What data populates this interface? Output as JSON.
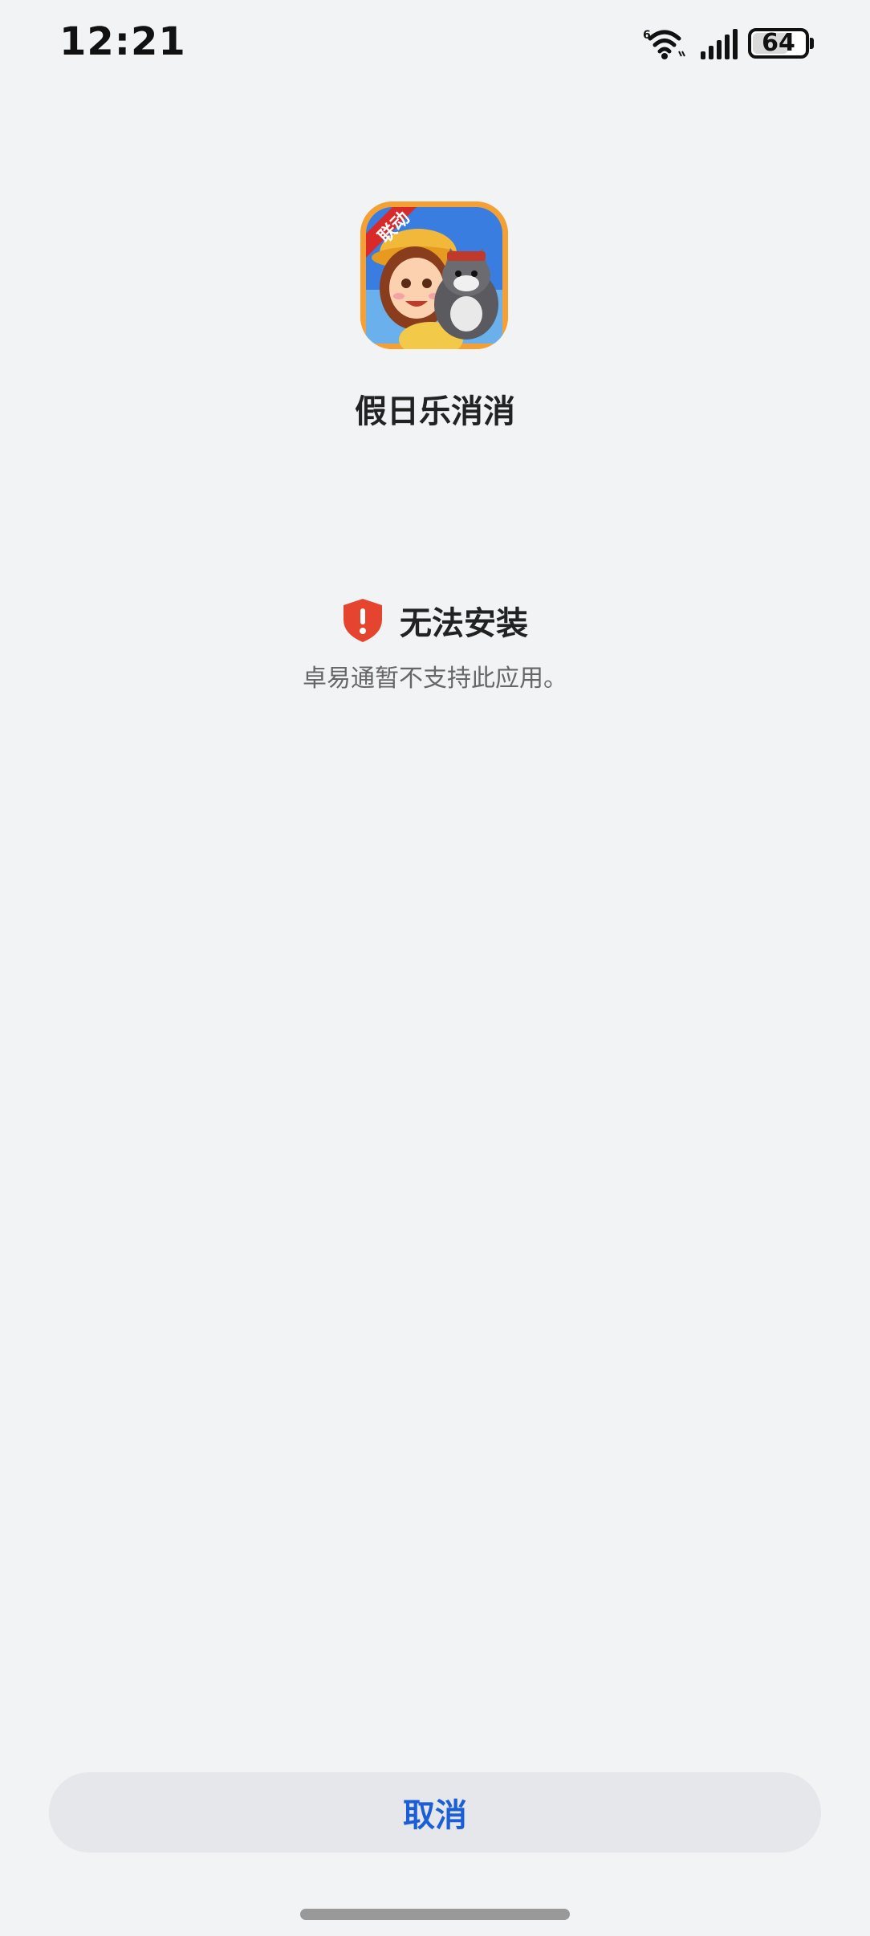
{
  "status_bar": {
    "time": "12:21",
    "network_label": "6",
    "battery_level": "64"
  },
  "app": {
    "name": "假日乐消消",
    "icon_badge": "联动",
    "icon": "game-app-icon"
  },
  "error": {
    "title": "无法安装",
    "message": "卓易通暂不支持此应用。",
    "icon": "shield-alert-icon",
    "color": "#e5452f"
  },
  "actions": {
    "cancel_label": "取消",
    "accent_color": "#1a5fd6"
  }
}
